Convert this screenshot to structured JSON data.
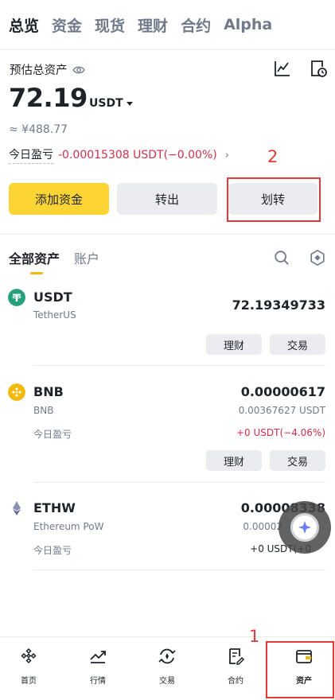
{
  "header": {
    "tabs": [
      "总览",
      "资金",
      "现货",
      "理财",
      "合约",
      "Alpha"
    ],
    "active_tab": "总览"
  },
  "summary": {
    "label": "预估总资产",
    "balance": "72.19",
    "currency": "USDT",
    "approx": "≈ ¥488.77",
    "pnl_label": "今日盈亏",
    "pnl_value": "-0.00015308 USDT(−0.00%)"
  },
  "actions": {
    "deposit": "添加资金",
    "withdraw": "转出",
    "transfer": "划转"
  },
  "annotations": {
    "transfer_marker": "2",
    "assets_marker": "1"
  },
  "asset_tabs": [
    "全部资产",
    "账户"
  ],
  "assets": [
    {
      "symbol": "USDT",
      "name": "TetherUS",
      "amount": "72.19349733",
      "earn_label": "理财",
      "trade_label": "交易"
    },
    {
      "symbol": "BNB",
      "name": "BNB",
      "amount": "0.00000617",
      "usd": "0.00367627 USDT",
      "pnl_label": "今日盈亏",
      "pnl": "+0 USDT(−4.06%)",
      "earn_label": "理财",
      "trade_label": "交易"
    },
    {
      "symbol": "ETHW",
      "name": "Ethereum PoW",
      "amount": "0.00008338",
      "usd": "0.00002",
      "pnl_label": "今日盈亏",
      "pnl": "+0 USDT(+0"
    }
  ],
  "bottom_nav": [
    {
      "label": "首页",
      "icon": "home-icon"
    },
    {
      "label": "行情",
      "icon": "markets-icon"
    },
    {
      "label": "交易",
      "icon": "trade-icon"
    },
    {
      "label": "合约",
      "icon": "futures-icon"
    },
    {
      "label": "资产",
      "icon": "wallet-icon"
    }
  ],
  "colors": {
    "accent": "#fcd535",
    "loss": "#cf304a",
    "muted": "#707a8a",
    "annotation": "#e53935"
  }
}
